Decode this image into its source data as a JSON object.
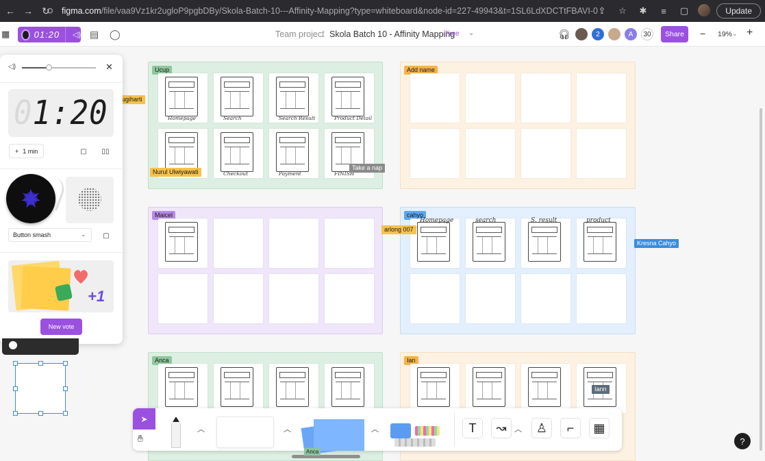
{
  "browser": {
    "url_host": "figma.com",
    "url_path": "/file/vaa9Vz1kr2ugloP9pgbDBy/Skola-Batch-10---Affinity-Mapping?type=whiteboard&node-id=227-49943&t=1SL6LdXDCTtFBAVI-0",
    "update_label": "Update",
    "icons": [
      "back-arrow-icon",
      "forward-arrow-icon",
      "reload-icon",
      "site-info-icon",
      "share-icon",
      "bookmark-star-icon",
      "extensions-icon",
      "media-controls-icon",
      "side-panel-icon"
    ]
  },
  "toolbar": {
    "timer_display": "01:20",
    "breadcrumb_team": "Team project",
    "breadcrumb_sep": "/",
    "file_name": "Skola Batch 10 - Affinity Mapping",
    "plan_badge": "Free",
    "chevron": "⌄",
    "avatar_count": "2",
    "avatar_letter": "A",
    "observers_count": "30",
    "share_label": "Share",
    "zoom_label": "19%",
    "zoom_minus": "−",
    "zoom_plus": "+"
  },
  "panel": {
    "volume_level": 0.36,
    "clock_digit_ghost": "0",
    "clock_rest": "1:20",
    "add_minute_label": "1 min",
    "add_minute_prefix": "+",
    "sound_select": "Button smash",
    "new_vote_label": "New vote"
  },
  "sections": [
    {
      "label": "Ucup",
      "color": "#dcefe2",
      "border": "#bfe0c8",
      "tag": "#8fc79e"
    },
    {
      "label": "Add name",
      "color": "#fdf1e2",
      "border": "#f7dfc1",
      "tag": "#f6b24a"
    },
    {
      "label": "Maicel",
      "color": "#efe6fa",
      "border": "#dccbf3",
      "tag": "#b58be6"
    },
    {
      "label": "cahyo",
      "color": "#e3effd",
      "border": "#c5dcf8",
      "tag": "#5aa6f2"
    },
    {
      "label": "Anca",
      "color": "#dcefe2",
      "border": "#bfe0c8",
      "tag": "#8fc79e"
    },
    {
      "label": "Ian",
      "color": "#fdf1e2",
      "border": "#f7dfc1",
      "tag": "#f6b24a"
    }
  ],
  "sketch_captions": {
    "ucup": [
      "Homepage",
      "Search",
      "Search Result",
      "Product Detail",
      "",
      "Checkout",
      "Payment",
      "FINISH"
    ],
    "cahyo": [
      "Homepage",
      "search",
      "S. result",
      "product"
    ]
  },
  "cursors": [
    {
      "name": "ugiharti",
      "color": "#f6c24a"
    },
    {
      "name": "Nurul Ulwiyawati",
      "color": "#f6c24a"
    },
    {
      "name": "Take a nap",
      "color": "#8a8a8a"
    },
    {
      "name": "arlong 007",
      "color": "#f6c24a"
    },
    {
      "name": "Kresna Cahyo",
      "color": "#3a8dde"
    },
    {
      "name": "Iann",
      "color": "#5d6b7a"
    },
    {
      "name": "Anca",
      "color": "#8bc4a0"
    }
  ],
  "help_label": "?"
}
